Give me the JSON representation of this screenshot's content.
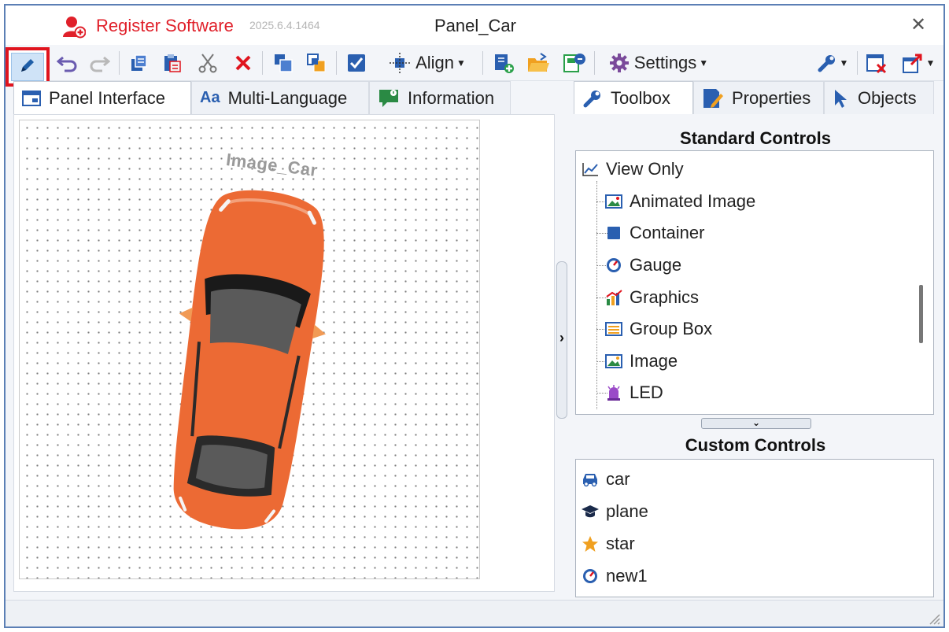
{
  "titlebar": {
    "app_label": "Register Software",
    "version": "2025.6.4.1464",
    "window_title": "Panel_Car",
    "close_glyph": "✕"
  },
  "toolbar": {
    "align_label": "Align",
    "settings_label": "Settings",
    "icons": [
      "edit-icon",
      "undo-icon",
      "redo-icon",
      "copy-icon",
      "paste-icon",
      "cut-icon",
      "delete-icon",
      "bring-front-icon",
      "send-back-icon",
      "checkbox-icon",
      "align-icon",
      "add-panel-icon",
      "open-folder-icon",
      "export-icon",
      "settings-icon",
      "wrench-icon",
      "close-panel-icon",
      "popout-icon"
    ]
  },
  "left_tabs": [
    {
      "label": "Panel Interface",
      "icon": "panel-icon",
      "active": true
    },
    {
      "label": "Multi-Language",
      "icon_text": "Aa",
      "active": false
    },
    {
      "label": "Information",
      "icon": "info-chat-icon",
      "active": false
    }
  ],
  "canvas": {
    "image_label": "Image_Car",
    "car_color": "#ec6a34"
  },
  "right_tabs": [
    {
      "label": "Toolbox",
      "icon": "wrench-icon",
      "active": true
    },
    {
      "label": "Properties",
      "icon": "properties-icon",
      "active": false
    },
    {
      "label": "Objects",
      "icon": "cursor-icon",
      "active": false
    }
  ],
  "standard_controls": {
    "title": "Standard Controls",
    "group": "View Only",
    "items": [
      "Animated Image",
      "Container",
      "Gauge",
      "Graphics",
      "Group Box",
      "Image",
      "LED"
    ]
  },
  "custom_controls": {
    "title": "Custom Controls",
    "items": [
      "car",
      "plane",
      "star",
      "new1"
    ]
  },
  "colors": {
    "accent_red": "#e0141e",
    "brand_red": "#e0202a",
    "blue": "#2a5fb0",
    "orange": "#ec6a34"
  }
}
